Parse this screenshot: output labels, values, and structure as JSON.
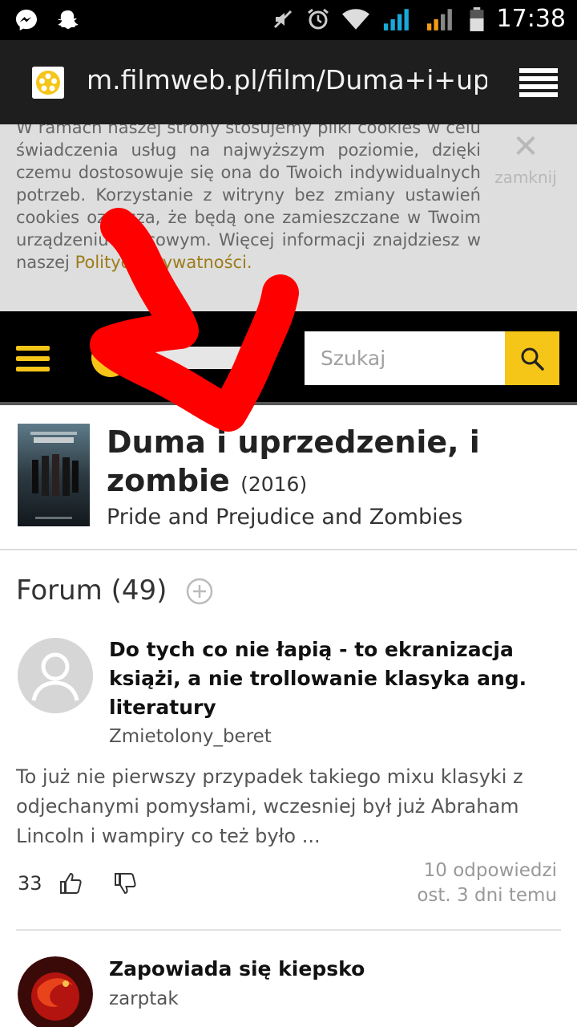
{
  "status_bar": {
    "time": "17:38",
    "left_icons": [
      "messenger-icon",
      "snapchat-icon"
    ],
    "right_icons": [
      "mute-icon",
      "alarm-icon",
      "wifi-icon",
      "signal-sim1-icon",
      "signal-sim2-icon",
      "battery-icon"
    ]
  },
  "browser": {
    "url": "m.filmweb.pl/film/Duma+i+uprzedzenie"
  },
  "cookie": {
    "text": "W ramach naszej strony stosujemy pliki cookies w celu świadczenia usług na najwyższym poziomie, dzięki czemu dostosowuje się ona do Twoich indywidualnych potrzeb. Korzystanie z witryny bez zmiany ustawień cookies oznacza, że będą one zamieszczane w Twoim urządzeniu końcowym. Więcej informacji znajdziesz w naszej ",
    "link": "Polityce Prywatności.",
    "close_label": "zamknij",
    "close_symbol": "✕"
  },
  "header": {
    "search_placeholder": "Szukaj"
  },
  "film": {
    "title": "Duma i uprzedzenie, i zombie",
    "year": "(2016)",
    "original_title": "Pride and Prejudice and Zombies"
  },
  "forum": {
    "heading": "Forum (49)",
    "posts": [
      {
        "title": "Do tych co nie łapią - to ekranizacja książi, a nie trollowanie klasyka ang. literatury",
        "author": "Zmietolony_beret",
        "excerpt": "To już nie pierwszy przypadek takiego mixu klasyki z odjechanymi pomysłami, wczesniej był już Abraham Lincoln i wampiry co też było ...",
        "votes": "33",
        "replies": "10 odpowiedzi",
        "last": "ost. 3 dni temu"
      },
      {
        "title": "Zapowiada się kiepsko",
        "author": "zarptak"
      }
    ]
  },
  "colors": {
    "accent": "#f5c518",
    "annotation_arrow": "#ff0000"
  }
}
